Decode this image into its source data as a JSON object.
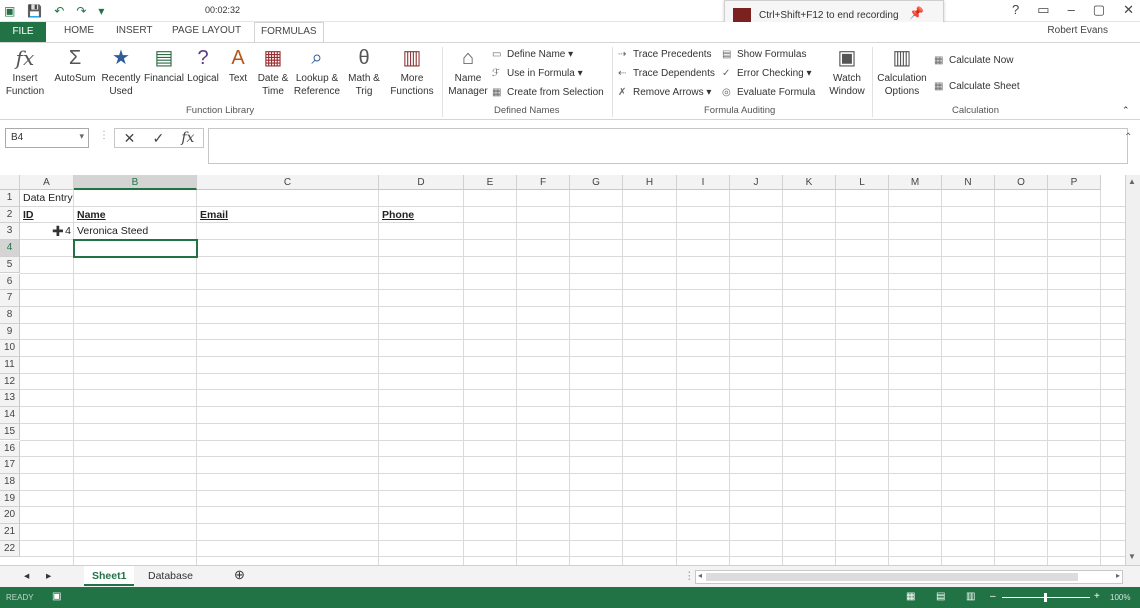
{
  "titlebar": {
    "timer": "00:02:32",
    "recording_hint": "Ctrl+Shift+F12 to end recording",
    "user": "Robert Evans"
  },
  "tabs": {
    "file": "FILE",
    "home": "HOME",
    "insert": "INSERT",
    "pagelayout": "PAGE LAYOUT",
    "formulas": "FORMULAS"
  },
  "ribbon": {
    "insert_function": "Insert Function",
    "autosum": "AutoSum",
    "recently_used": "Recently Used",
    "financial": "Financial",
    "logical": "Logical",
    "text": "Text",
    "date_time": "Date & Time",
    "lookup": "Lookup & Reference",
    "math": "Math & Trig",
    "more": "More Functions",
    "group_library": "Function Library",
    "name_manager": "Name Manager",
    "define_name": "Define Name",
    "use_in_formula": "Use in Formula",
    "create_from_selection": "Create from Selection",
    "group_names": "Defined Names",
    "trace_precedents": "Trace Precedents",
    "trace_dependents": "Trace Dependents",
    "remove_arrows": "Remove Arrows",
    "show_formulas": "Show Formulas",
    "error_checking": "Error Checking",
    "evaluate_formula": "Evaluate Formula",
    "watch_window": "Watch Window",
    "group_auditing": "Formula Auditing",
    "calc_options": "Calculation Options",
    "calc_now": "Calculate Now",
    "calc_sheet": "Calculate Sheet",
    "group_calc": "Calculation"
  },
  "formula_bar": {
    "name_box": "B4",
    "value": ""
  },
  "grid": {
    "columns": [
      "A",
      "B",
      "C",
      "D",
      "E",
      "F",
      "G",
      "H",
      "I",
      "J",
      "K",
      "L",
      "M",
      "N",
      "O",
      "P"
    ],
    "rows": [
      "1",
      "2",
      "3",
      "4",
      "5",
      "6",
      "7",
      "8",
      "9",
      "10",
      "11",
      "12",
      "13",
      "14",
      "15",
      "16",
      "17",
      "18",
      "19",
      "20",
      "21",
      "22"
    ],
    "a1": "Data Entry",
    "a2": "ID",
    "b2": "Name",
    "c2": "Email",
    "d2": "Phone",
    "a3": "4",
    "b3": "Veronica Steed"
  },
  "sheets": {
    "sheet1": "Sheet1",
    "database": "Database",
    "add": "⊕"
  },
  "status": {
    "left": "READY",
    "zoom": "100%"
  }
}
